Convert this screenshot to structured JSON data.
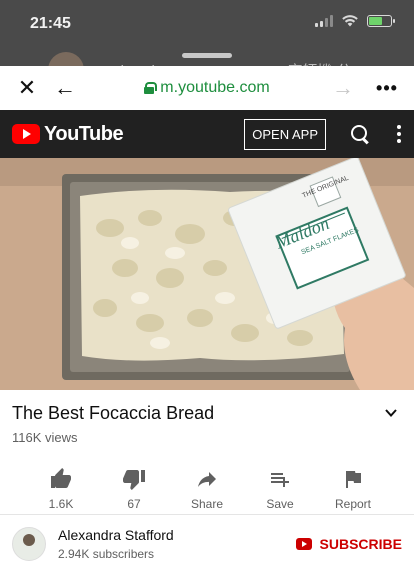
{
  "status_bar": {
    "time": "21:45",
    "battery_level": 0.6,
    "battery_color": "#6fd36b"
  },
  "behind_page": {
    "text": "Rosita Chung ▶ HK BOSCH 廚師機 分"
  },
  "browser": {
    "url": "m.youtube.com",
    "close_icon": "close-icon",
    "back_icon": "arrow-left-icon",
    "forward_icon": "arrow-right-icon",
    "more_icon": "more-horizontal-icon",
    "url_color": "#1e8e3e"
  },
  "youtube_header": {
    "logo_text": "YouTube",
    "open_app_label": "OPEN APP",
    "brand_color": "#ff0000",
    "background": "#212121"
  },
  "video": {
    "thumbnail_description_icon": "video-frame",
    "box_brand": "Maldon",
    "box_text": "SEA SALT FLAKES",
    "box_top_text": "THE ORIGINAL"
  },
  "video_meta": {
    "title": "The Best Focaccia Bread",
    "views": "116K views"
  },
  "actions": [
    {
      "icon": "thumbs-up-icon",
      "label": "1.6K"
    },
    {
      "icon": "thumbs-down-icon",
      "label": "67"
    },
    {
      "icon": "share-icon",
      "label": "Share"
    },
    {
      "icon": "playlist-add-icon",
      "label": "Save"
    },
    {
      "icon": "flag-icon",
      "label": "Report"
    }
  ],
  "channel": {
    "name": "Alexandra Stafford",
    "subscribers": "2.94K subscribers",
    "subscribe_label": "SUBSCRIBE",
    "subscribe_color": "#cc0000"
  }
}
